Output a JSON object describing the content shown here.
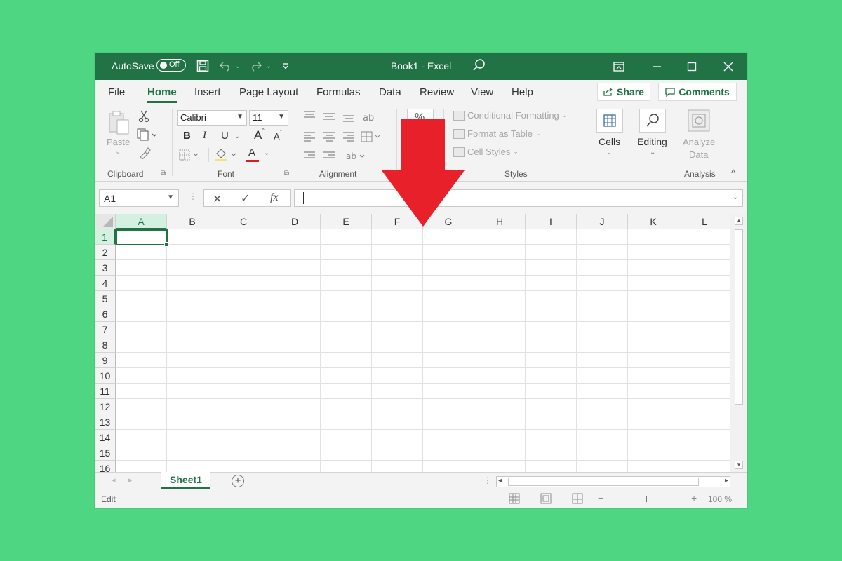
{
  "window": {
    "autosave_label": "AutoSave",
    "autosave_state": "Off",
    "title": "Book1  -  Excel"
  },
  "tabs": [
    "File",
    "Home",
    "Insert",
    "Page Layout",
    "Formulas",
    "Data",
    "Review",
    "View",
    "Help"
  ],
  "active_tab": "Home",
  "share_label": "Share",
  "comments_label": "Comments",
  "ribbon": {
    "clipboard": {
      "paste_label": "Paste",
      "group_label": "Clipboard"
    },
    "font": {
      "name": "Calibri",
      "size": "11",
      "bold": "B",
      "italic": "I",
      "underline": "U",
      "grow": "A",
      "shrink": "A",
      "color_a": "A",
      "group_label": "Font"
    },
    "alignment": {
      "group_label": "Alignment"
    },
    "number": {
      "percent": "%"
    },
    "styles": {
      "conditional_formatting": "Conditional Formatting",
      "format_as_table": "Format as Table",
      "cell_styles": "Cell Styles",
      "group_label": "Styles"
    },
    "cells": {
      "label": "Cells"
    },
    "editing": {
      "label": "Editing"
    },
    "analysis": {
      "analyze_line1": "Analyze",
      "analyze_line2": "Data",
      "group_label": "Analysis"
    }
  },
  "formula_bar": {
    "name_box": "A1",
    "fx": "fx",
    "formula_value": ""
  },
  "grid": {
    "columns": [
      "A",
      "B",
      "C",
      "D",
      "E",
      "F",
      "G",
      "H",
      "I",
      "J",
      "K",
      "L"
    ],
    "rows": [
      "1",
      "2",
      "3",
      "4",
      "5",
      "6",
      "7",
      "8",
      "9",
      "10",
      "11",
      "12",
      "13",
      "14",
      "15",
      "16"
    ],
    "active_cell": "A1"
  },
  "sheet_tab": "Sheet1",
  "status": {
    "mode": "Edit",
    "zoom": "100 %"
  },
  "colors": {
    "excel_green": "#217346",
    "background": "#4fd683",
    "overlay_arrow": "#e8202a"
  },
  "overlay": {
    "icon": "red-down-arrow-icon"
  }
}
